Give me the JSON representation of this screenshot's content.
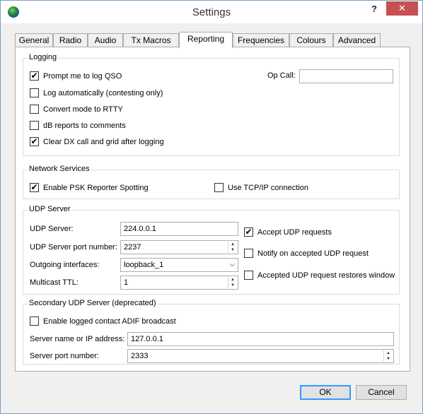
{
  "window": {
    "title": "Settings",
    "help": "?",
    "close": "✕"
  },
  "tabs": [
    {
      "label": "General"
    },
    {
      "label": "Radio"
    },
    {
      "label": "Audio"
    },
    {
      "label": "Tx Macros"
    },
    {
      "label": "Reporting"
    },
    {
      "label": "Frequencies"
    },
    {
      "label": "Colours"
    },
    {
      "label": "Advanced"
    }
  ],
  "active_tab": "Reporting",
  "logging": {
    "title": "Logging",
    "prompt_qso": {
      "label": "Prompt me to log QSO",
      "checked": true
    },
    "log_auto": {
      "label": "Log automatically (contesting only)",
      "checked": false
    },
    "convert_rtty": {
      "label": "Convert mode to RTTY",
      "checked": false
    },
    "db_reports": {
      "label": "dB reports to comments",
      "checked": false
    },
    "clear_dx": {
      "label": "Clear DX call and grid after logging",
      "checked": true
    },
    "op_call_label": "Op Call:",
    "op_call_value": ""
  },
  "network": {
    "title": "Network Services",
    "psk": {
      "label": "Enable PSK Reporter Spotting",
      "checked": true
    },
    "tcpip": {
      "label": "Use TCP/IP connection",
      "checked": false
    }
  },
  "udp": {
    "title": "UDP Server",
    "server_label": "UDP Server:",
    "server_value": "224.0.0.1",
    "port_label": "UDP Server port number:",
    "port_value": "2237",
    "outgoing_label": "Outgoing interfaces:",
    "outgoing_value": "loopback_1",
    "ttl_label": "Multicast TTL:",
    "ttl_value": "1",
    "accept": {
      "label": "Accept UDP requests",
      "checked": true
    },
    "notify": {
      "label": "Notify on accepted UDP request",
      "checked": false
    },
    "restore": {
      "label": "Accepted UDP request restores window",
      "checked": false
    }
  },
  "secondary": {
    "title": "Secondary UDP Server (deprecated)",
    "enable": {
      "label": "Enable logged contact ADIF broadcast",
      "checked": false
    },
    "name_label": "Server name or IP address:",
    "name_value": "127.0.0.1",
    "port_label": "Server port number:",
    "port_value": "2333"
  },
  "buttons": {
    "ok": "OK",
    "cancel": "Cancel"
  },
  "icons": {
    "check": "✔",
    "up": "▲",
    "down": "▼",
    "dropdown": "⌵"
  }
}
